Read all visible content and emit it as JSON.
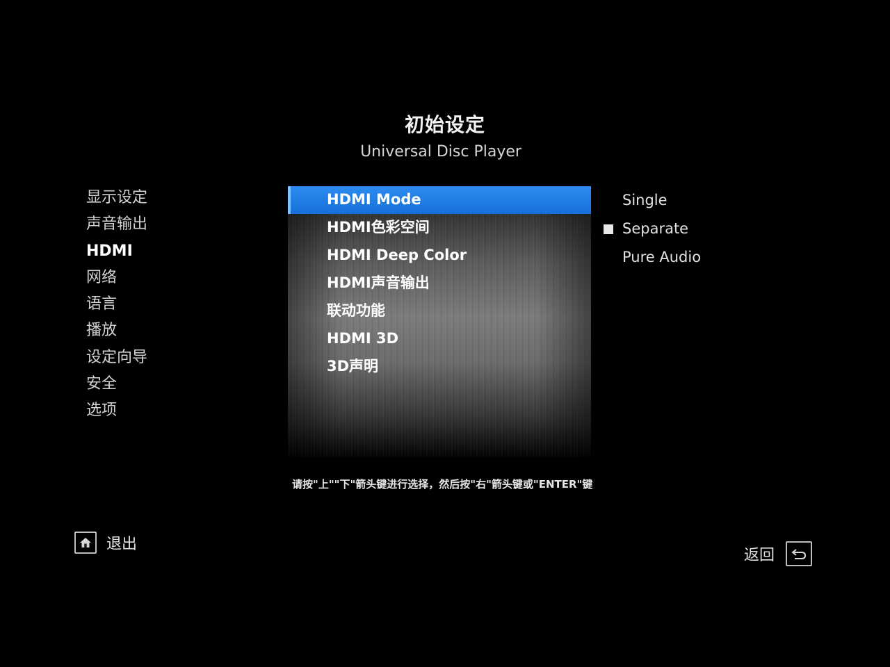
{
  "header": {
    "title": "初始设定",
    "subtitle": "Universal Disc Player"
  },
  "sidebar": {
    "items": [
      {
        "label": "显示设定",
        "active": false
      },
      {
        "label": "声音输出",
        "active": false
      },
      {
        "label": "HDMI",
        "active": true
      },
      {
        "label": "网络",
        "active": false
      },
      {
        "label": "语言",
        "active": false
      },
      {
        "label": "播放",
        "active": false
      },
      {
        "label": "设定向导",
        "active": false
      },
      {
        "label": "安全",
        "active": false
      },
      {
        "label": "选项",
        "active": false
      }
    ]
  },
  "menu": {
    "items": [
      {
        "label": "HDMI Mode",
        "selected": true
      },
      {
        "label": "HDMI色彩空间",
        "selected": false
      },
      {
        "label": "HDMI Deep Color",
        "selected": false
      },
      {
        "label": "HDMI声音输出",
        "selected": false
      },
      {
        "label": "联动功能",
        "selected": false
      },
      {
        "label": "HDMI 3D",
        "selected": false
      },
      {
        "label": "3D声明",
        "selected": false
      }
    ]
  },
  "options": {
    "items": [
      {
        "label": "Single",
        "checked": false
      },
      {
        "label": "Separate",
        "checked": true
      },
      {
        "label": "Pure Audio",
        "checked": false
      }
    ]
  },
  "hint": "请按\"上\"\"下\"箭头键进行选择，然后按\"右\"箭头键或\"ENTER\"键",
  "footer": {
    "exit_label": "退出",
    "exit_icon": "home-icon",
    "back_label": "返回",
    "back_icon": "return-arrow-icon"
  },
  "colors": {
    "highlight": "#1a7ae6",
    "background": "#000000"
  }
}
